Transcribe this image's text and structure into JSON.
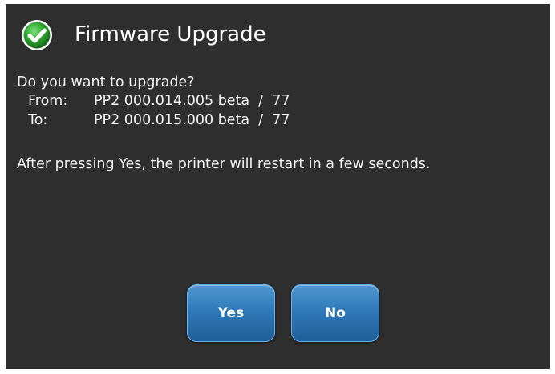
{
  "dialog": {
    "title": "Firmware Upgrade",
    "title_icon": "check-circle-icon",
    "question": "Do you want to upgrade?",
    "from_label": "From:",
    "from_value": "PP2 000.014.005 beta  /  77",
    "to_label": "To:",
    "to_value": "PP2 000.015.000 beta  /  77",
    "note": "After pressing Yes, the printer will restart in a few seconds.",
    "yes_label": "Yes",
    "no_label": "No"
  },
  "colors": {
    "background": "#2e2e2e",
    "accent_green": "#2ea52e",
    "button_blue": "#2f79b8"
  }
}
